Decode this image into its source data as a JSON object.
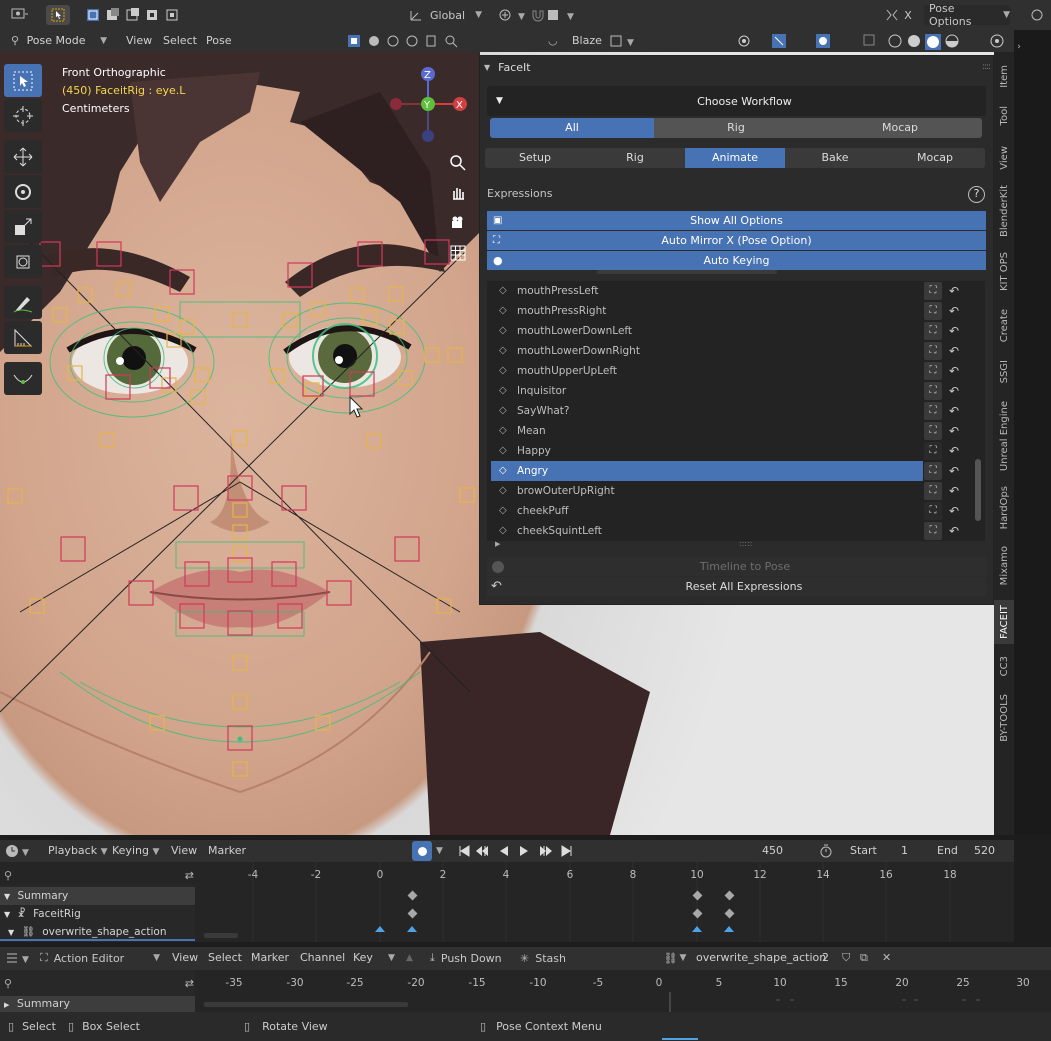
{
  "header": {
    "transform_orientation": "Global",
    "pose_options": "Pose Options",
    "x_label": "X",
    "mode": "Pose Mode",
    "menus": [
      "View",
      "Select",
      "Pose"
    ],
    "pivot_label": "Blaze"
  },
  "viewport": {
    "view_name": "Front Orthographic",
    "active_object": "(450) FaceitRig : eye.L",
    "units": "Centimeters",
    "gizmo_axes": [
      "Z",
      "Y",
      "X"
    ]
  },
  "side_tabs": [
    "Item",
    "Tool",
    "View",
    "BlenderKit",
    "KIT OPS",
    "Create",
    "SSGI",
    "Unreal Engine",
    "HardOps",
    "Mixamo",
    "FACEIT",
    "CC3",
    "BY-TOOLS"
  ],
  "active_side_tab": "FACEIT",
  "panel": {
    "title": "FaceIt",
    "workflow_title": "Choose Workflow",
    "workflow_tabs": [
      "All",
      "Rig",
      "Mocap"
    ],
    "workflow_selected": "All",
    "stage_tabs": [
      "Setup",
      "Rig",
      "Animate",
      "Bake",
      "Mocap"
    ],
    "stage_selected": "Animate",
    "expressions_label": "Expressions",
    "help_icon": "?",
    "options": [
      "Show All Options",
      "Auto Mirror X (Pose Option)",
      "Auto Keying"
    ],
    "expressions": [
      "mouthPressLeft",
      "mouthPressRight",
      "mouthLowerDownLeft",
      "mouthLowerDownRight",
      "mouthUpperUpLeft",
      "Inquisitor",
      "SayWhat?",
      "Mean",
      "Happy",
      "Angry",
      "browOuterUpRight",
      "cheekPuff",
      "cheekSquintLeft"
    ],
    "selected_expression": "Angry",
    "timeline_to_pose": "Timeline to Pose",
    "reset_all": "Reset All Expressions"
  },
  "timeline": {
    "menus": [
      "Playback",
      "Keying",
      "View",
      "Marker"
    ],
    "current_frame": "450",
    "start_label": "Start",
    "start_value": "1",
    "end_label": "End",
    "end_value": "520",
    "ticks": [
      "-4",
      "-2",
      "0",
      "2",
      "4",
      "6",
      "8",
      "10",
      "12",
      "14",
      "16",
      "18"
    ],
    "channels": [
      "Summary",
      "FaceitRig",
      "overwrite_shape_action"
    ]
  },
  "action_editor": {
    "mode": "Action Editor",
    "menus": [
      "View",
      "Select",
      "Marker",
      "Channel",
      "Key"
    ],
    "push_down": "Push Down",
    "stash": "Stash",
    "action_name": "overwrite_shape_action",
    "users": "2",
    "ticks": [
      "-35",
      "-30",
      "-25",
      "-20",
      "-15",
      "-10",
      "-5",
      "0",
      "5",
      "10",
      "15",
      "20",
      "25",
      "30"
    ],
    "channel": "Summary"
  },
  "status_bar": {
    "items": [
      "Select",
      "Box Select",
      "Rotate View",
      "Pose Context Menu"
    ]
  },
  "colors": {
    "accent": "#4772b3",
    "bg": "#1d1d1d",
    "panel": "#2b2b2b",
    "key_blue": "#4da3e8",
    "bone_yellow": "#e6b44c",
    "bone_red": "#d2385a",
    "bone_green": "#3fbf7f"
  }
}
